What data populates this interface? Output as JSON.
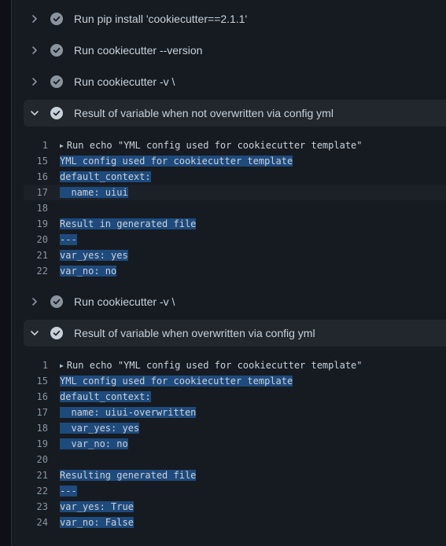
{
  "steps": [
    {
      "label": "Run pip install 'cookiecutter==2.1.1'",
      "expanded": false
    },
    {
      "label": "Run cookiecutter --version",
      "expanded": false
    },
    {
      "label": "Run cookiecutter -v \\",
      "expanded": false
    },
    {
      "label": "Result of variable when not overwritten via config yml",
      "expanded": true
    },
    {
      "label": "Run cookiecutter -v \\",
      "expanded": false
    },
    {
      "label": "Result of variable when overwritten via config yml",
      "expanded": true
    }
  ],
  "log1": [
    {
      "n": "1",
      "t": "Run echo \"YML config used for cookiecutter template\""
    },
    {
      "n": "15",
      "t": "YML config used for cookiecutter template"
    },
    {
      "n": "16",
      "t": "default_context:"
    },
    {
      "n": "17",
      "t": "  name: uiui"
    },
    {
      "n": "18",
      "t": ""
    },
    {
      "n": "19",
      "t": "Result in generated file"
    },
    {
      "n": "20",
      "t": "---"
    },
    {
      "n": "21",
      "t": "var_yes: yes"
    },
    {
      "n": "22",
      "t": "var_no: no"
    }
  ],
  "log2": [
    {
      "n": "1",
      "t": "Run echo \"YML config used for cookiecutter template\""
    },
    {
      "n": "15",
      "t": "YML config used for cookiecutter template"
    },
    {
      "n": "16",
      "t": "default_context:"
    },
    {
      "n": "17",
      "t": "  name: uiui-overwritten"
    },
    {
      "n": "18",
      "t": "  var_yes: yes"
    },
    {
      "n": "19",
      "t": "  var_no: no"
    },
    {
      "n": "20",
      "t": ""
    },
    {
      "n": "21",
      "t": "Resulting generated file"
    },
    {
      "n": "22",
      "t": "---"
    },
    {
      "n": "23",
      "t": "var_yes: True"
    },
    {
      "n": "24",
      "t": "var_no: False"
    }
  ],
  "colors": {
    "check": "#8b949e",
    "selection": "#1f4a7c",
    "background": "#161b22"
  }
}
